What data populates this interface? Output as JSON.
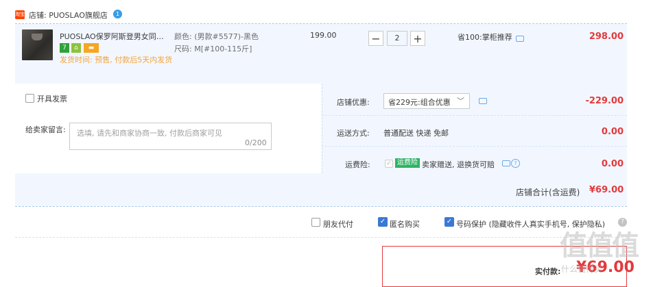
{
  "shop": {
    "icon_text": "淘宝",
    "name": "店铺: PUOSLAO旗舰店",
    "badge": "1"
  },
  "item": {
    "title": "PUOSLAO保罗阿斯登男女同款...",
    "tags": [
      "7",
      "⌂",
      "▬"
    ],
    "ship_time": "发货时间: 预售, 付款后5天内发货",
    "spec_color": "颜色: (男款#5577)-黑色",
    "spec_size": "尺码: M[#100-115斤]",
    "unit_price": "199.00",
    "quantity": "2",
    "minus": "−",
    "plus": "+",
    "promo": "省100:掌柜推荐",
    "subtotal": "298.00"
  },
  "invoice": {
    "label": "开具发票"
  },
  "message": {
    "label": "给卖家留言:",
    "placeholder": "选填, 请先和商家协商一致, 付款后商家可见",
    "count": "0/200"
  },
  "discount": {
    "label": "店铺优惠:",
    "selected": "省229元:组合优惠",
    "arrow": "﹀",
    "amount": "-229.00"
  },
  "shipping": {
    "label": "运送方式:",
    "value": "普通配送 快递 免邮",
    "amount": "0.00"
  },
  "insurance": {
    "label": "运费险:",
    "tag": "运费险",
    "value": "卖家赠送, 退换货可赔",
    "amount": "0.00"
  },
  "shop_total": {
    "label": "店铺合计(含运费)",
    "value": "¥69.00"
  },
  "options": {
    "friend_pay": "朋友代付",
    "anonymous": "匿名购买",
    "number_protect": "号码保护 (隐藏收件人真实手机号, 保护隐私)",
    "help": "?"
  },
  "payment": {
    "label": "实付款:",
    "value": "¥69.00"
  },
  "watermark": {
    "text": "值值值",
    "sub": "什么值得买"
  },
  "colors": {
    "accent_red": "#e4393c",
    "row_bg": "#f2f7ff",
    "promo_orange": "#f4a33b",
    "check_blue": "#3a78d6",
    "insurance_green": "#2fb464"
  }
}
